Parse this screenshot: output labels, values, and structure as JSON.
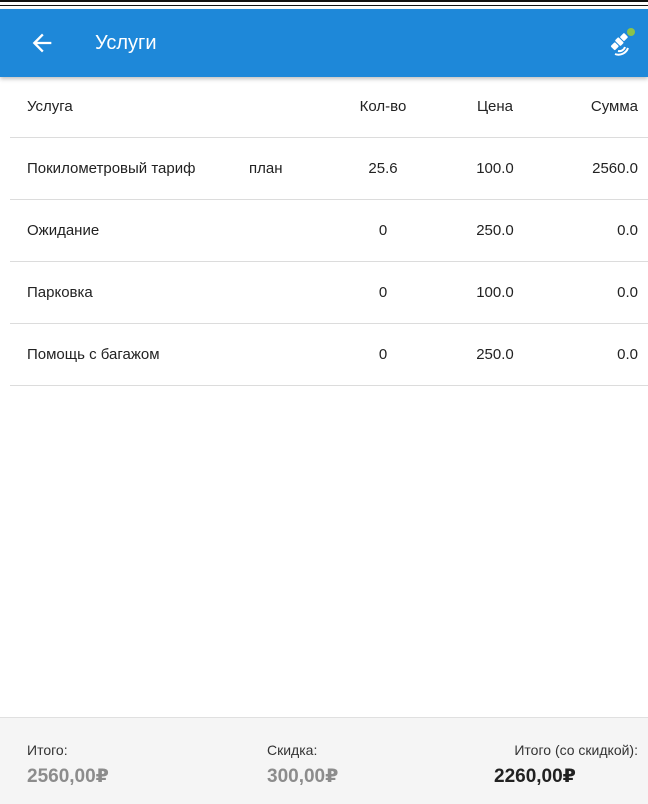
{
  "appbar": {
    "title": "Услуги",
    "color": "#1e88d9",
    "back_icon": "arrow-left-icon",
    "status_icon": "satellite-gps-icon",
    "status_dot_color": "#8bc34a"
  },
  "table": {
    "headers": {
      "service": "Услуга",
      "qty": "Кол-во",
      "price": "Цена",
      "sum": "Сумма"
    },
    "rows": [
      {
        "name": "Покилометровый тариф",
        "tag": "план",
        "qty": "25.6",
        "price": "100.0",
        "sum": "2560.0"
      },
      {
        "name": "Ожидание",
        "tag": "",
        "qty": "0",
        "price": "250.0",
        "sum": "0.0"
      },
      {
        "name": "Парковка",
        "tag": "",
        "qty": "0",
        "price": "100.0",
        "sum": "0.0"
      },
      {
        "name": "Помощь с багажом",
        "tag": "",
        "qty": "0",
        "price": "250.0",
        "sum": "0.0"
      }
    ]
  },
  "footer": {
    "total_label": "Итого:",
    "total_value": "2560,00₽",
    "discount_label": "Скидка:",
    "discount_value": "300,00₽",
    "final_label": "Итого (со скидкой):",
    "final_value": "2260,00₽"
  }
}
